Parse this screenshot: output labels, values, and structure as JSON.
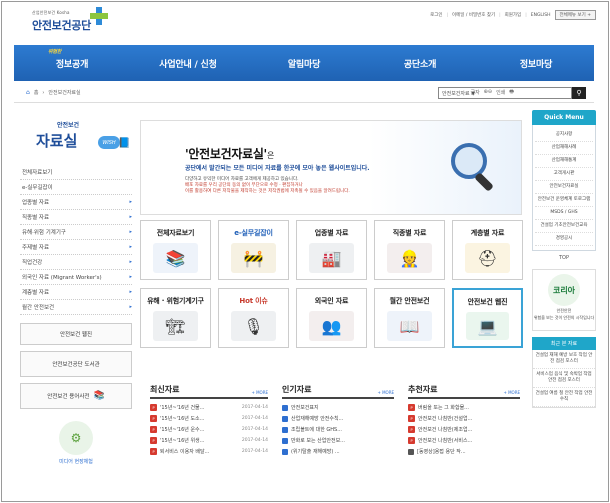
{
  "header": {
    "org_small": "산업안전보건 Kosha",
    "org_name": "안전보건공단",
    "util_links": [
      "로그인",
      "이메일 / 비밀번호 찾기",
      "회원가입",
      "ENGLISH"
    ],
    "sitemap_label": "전체메뉴 보기 +"
  },
  "gnb": {
    "badge": "위험한",
    "items": [
      "정보공개",
      "사업안내 / 신청",
      "알림마당",
      "공단소개",
      "정보마당"
    ]
  },
  "breadcrumb": {
    "home": "홈",
    "current": "안전보건자료실"
  },
  "tools": {
    "font_size": "글자",
    "print": "인쇄"
  },
  "search": {
    "value": "안전보건자료 ▼"
  },
  "lnb": {
    "title_small": "안전보건",
    "title": "자료실",
    "badge": "WISH",
    "items": [
      {
        "label": "전체자료보기",
        "arrow": ""
      },
      {
        "label": "e-실무길잡이",
        "arrow": ""
      },
      {
        "label": "업종별 자료",
        "arrow": "▸"
      },
      {
        "label": "직종별 자료",
        "arrow": "▸"
      },
      {
        "label": "유해·위험 기계기구",
        "arrow": "▸"
      },
      {
        "label": "주제별 자료",
        "arrow": "▸"
      },
      {
        "label": "직업건강",
        "arrow": "▸"
      },
      {
        "label": "외국인 자료 (Migrant Worker's)",
        "arrow": "▸"
      },
      {
        "label": "계층별 자료",
        "arrow": "▸"
      },
      {
        "label": "월간 안전보건",
        "arrow": "▸"
      }
    ],
    "banners": [
      "안전보건 웹진",
      "안전보건공단 도서관",
      "안전보건 용어사전"
    ],
    "media_label": "미디어 현장체험"
  },
  "hero": {
    "title": "'안전보건자료실'",
    "title_suffix": "은",
    "subtitle": "공단에서 발간되는 모든 미디어 자료를 한곳에 모아 놓은 웹사이트입니다.",
    "desc1": "다양하고 유익한 미디어 자료를 고객에게 제공하고 있습니다.",
    "desc2": "배포 자료를 우리 공단의 동의 없이 무단으로 수정 · 편집하거나",
    "desc3": "이를 활용하여 다른 저작물을 제작하는 것은 저작권법에 저촉될 수 있음을 알려드립니다."
  },
  "tiles": [
    {
      "label": "전체자료보기",
      "icon": "📚",
      "style": ""
    },
    {
      "label": "e-실무길잡이",
      "icon": "🚧",
      "style": "blue"
    },
    {
      "label": "업종별 자료",
      "icon": "🏭",
      "style": ""
    },
    {
      "label": "직종별 자료",
      "icon": "👷",
      "style": ""
    },
    {
      "label": "계층별 자료",
      "icon": "⛑",
      "style": ""
    },
    {
      "label": "유해 · 위험기계기구",
      "icon": "🏗",
      "style": ""
    },
    {
      "label": "Hot 이슈",
      "icon": "🎙",
      "style": "red"
    },
    {
      "label": "외국인 자료",
      "icon": "👥",
      "style": ""
    },
    {
      "label": "월간 안전보건",
      "icon": "📖",
      "style": ""
    },
    {
      "label": "안전보건 웹진",
      "icon": "💻",
      "style": ""
    }
  ],
  "boards": {
    "recent": {
      "title": "최신자료",
      "more": "+ MORE",
      "items": [
        {
          "text": "'15년~'16년 건물...",
          "date": "2017-04-14"
        },
        {
          "text": "'15년~'16년 도소...",
          "date": "2017-04-14"
        },
        {
          "text": "'15년~'16년 운수...",
          "date": "2017-04-14"
        },
        {
          "text": "'15년~'16년 위생...",
          "date": "2017-04-14"
        },
        {
          "text": "퇴서비스 이용자 배달...",
          "date": "2017-04-14"
        }
      ]
    },
    "popular": {
      "title": "인기자료",
      "more": "+ MORE",
      "items": [
        "안전보건표지",
        "산업재해예방 안전수칙...",
        "조립볼트에 대한 GHS...",
        "만화로 보는 산업안전보...",
        "(위기탈출 재해예방) ..."
      ]
    },
    "recommended": {
      "title": "추천자료",
      "more": "+ MORE",
      "items": [
        "버림을 또는 그 화합물...",
        "안전보건 나침반(건설업...",
        "안전보건 나침반(제조업...",
        "안전보건 나침반(서비스...",
        "[동영상]용접 용단 작..."
      ]
    }
  },
  "quick": {
    "title": "Quick Menu",
    "items": [
      "공지사항",
      "산업재해사례",
      "산업재해통계",
      "고객게시판",
      "안전보건자료실",
      "안전보건 운영체계 토로그램",
      "MSDS / GHS",
      "건설업 기초안전보건교육",
      "경영공시"
    ],
    "top": "TOP",
    "korea_title": "코리아",
    "korea_top": "안전안전",
    "korea_sub": "위험을 보는 것이 안전의 시작입니다",
    "recent_head": "최근 본 자료",
    "recent_items": [
      "건설업 재해 예방 보호 작업 안전 점검 포스터",
      "서비스업 음식 및 숙박업 작업 안전 점검 포스터",
      "건설업 여름 철 안전 작업 안전 수칙"
    ]
  }
}
